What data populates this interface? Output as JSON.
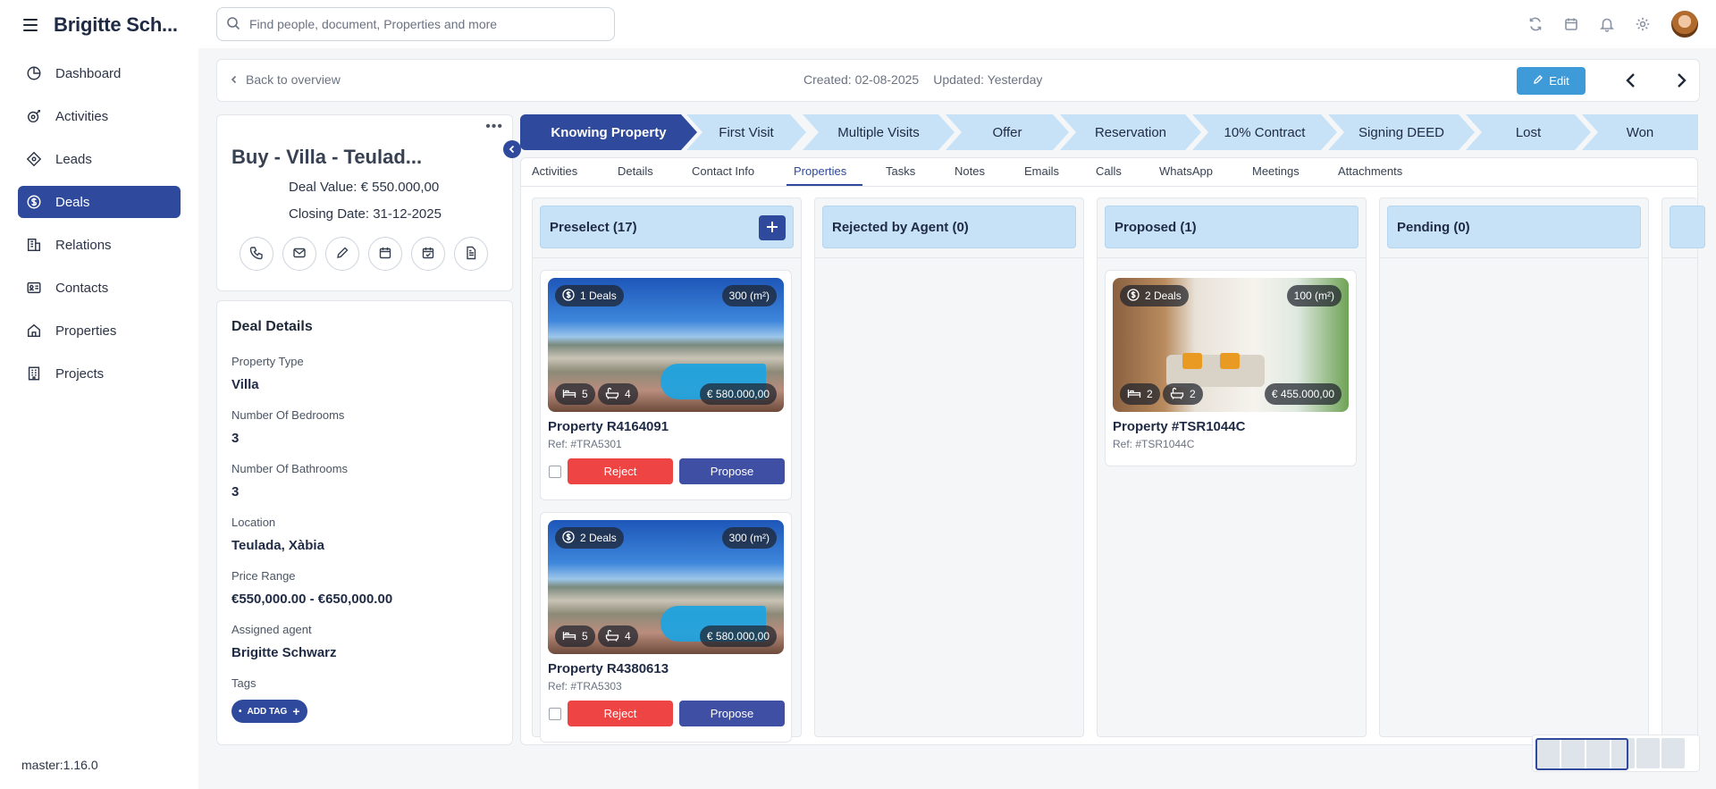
{
  "app": {
    "brand": "Brigitte Sch...",
    "version": "master:1.16.0"
  },
  "sidebar": {
    "items": [
      {
        "label": "Dashboard",
        "icon": "dashboard-icon"
      },
      {
        "label": "Activities",
        "icon": "activities-icon"
      },
      {
        "label": "Leads",
        "icon": "leads-icon"
      },
      {
        "label": "Deals",
        "icon": "deals-icon",
        "active": true
      },
      {
        "label": "Relations",
        "icon": "relations-icon"
      },
      {
        "label": "Contacts",
        "icon": "contacts-icon"
      },
      {
        "label": "Properties",
        "icon": "properties-icon"
      },
      {
        "label": "Projects",
        "icon": "projects-icon"
      }
    ]
  },
  "topbar": {
    "search_placeholder": "Find people, document, Properties and more",
    "icons": [
      "sync-icon",
      "calendar-icon",
      "bell-icon",
      "gear-icon",
      "user-avatar"
    ]
  },
  "header": {
    "back_label": "Back to overview",
    "created": "Created: 02-08-2025",
    "updated": "Updated: Yesterday",
    "edit_label": "Edit"
  },
  "deal": {
    "title": "Buy - Villa - Teulad...",
    "deal_value": "Deal Value:  € 550.000,00",
    "closing_date": "Closing Date: 31-12-2025"
  },
  "details": {
    "title": "Deal Details",
    "fields": [
      {
        "label": "Property Type",
        "value": "Villa"
      },
      {
        "label": "Number Of Bedrooms",
        "value": "3"
      },
      {
        "label": "Number Of Bathrooms",
        "value": "3"
      },
      {
        "label": "Location",
        "value": "Teulada, Xàbia"
      },
      {
        "label": "Price Range",
        "value": "€550,000.00 - €650,000.00"
      },
      {
        "label": "Assigned agent",
        "value": "Brigitte Schwarz"
      }
    ],
    "tags_label": "Tags",
    "add_tag_label": "ADD TAG"
  },
  "pipeline": {
    "stages": [
      "Knowing Property",
      "First Visit",
      "Multiple Visits",
      "Offer",
      "Reservation",
      "10% Contract",
      "Signing DEED",
      "Lost",
      "Won"
    ],
    "active_stage": "Knowing Property"
  },
  "tabs": {
    "items": [
      "Activities",
      "Details",
      "Contact Info",
      "Properties",
      "Tasks",
      "Notes",
      "Emails",
      "Calls",
      "WhatsApp",
      "Meetings",
      "Attachments"
    ],
    "active": "Properties"
  },
  "kanban": {
    "columns": [
      {
        "title": "Preselect (17)"
      },
      {
        "title": "Rejected by Agent (0)"
      },
      {
        "title": "Proposed (1)"
      },
      {
        "title": "Pending (0)"
      }
    ],
    "cards": [
      {
        "deals": "1 Deals",
        "area": "300 (m²)",
        "beds": "5",
        "baths": "4",
        "price": "€ 580.000,00",
        "name": "Property R4164091",
        "ref": "Ref: #TRA5301",
        "reject": "Reject",
        "propose": "Propose"
      },
      {
        "deals": "2 Deals",
        "area": "300 (m²)",
        "beds": "5",
        "baths": "4",
        "price": "€ 580.000,00",
        "name": "Property R4380613",
        "ref": "Ref: #TRA5303",
        "reject": "Reject",
        "propose": "Propose"
      },
      {
        "deals": "2 Deals",
        "area": "100 (m²)",
        "beds": "2",
        "baths": "2",
        "price": "€ 455.000,00",
        "name": "Property #TSR1044C",
        "ref": "Ref: #TSR1044C"
      }
    ]
  },
  "colors": {
    "primary": "#2f4a9c",
    "stage_bg": "#c7e2f6",
    "edit": "#3f9ad8",
    "reject": "#ee4444",
    "propose": "#3f4fa3"
  }
}
